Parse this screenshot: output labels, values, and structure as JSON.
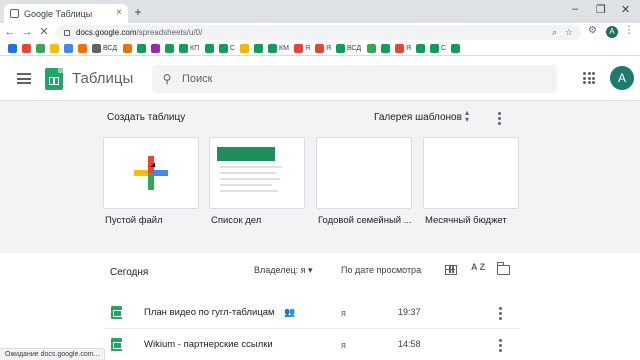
{
  "browser": {
    "tab_title": "Google Таблицы",
    "tab_close": "×",
    "new_tab": "+",
    "window_controls": [
      "–",
      "❐",
      "✕"
    ],
    "url_host": "docs.google.com",
    "url_path": "/spreadsheets/u/0/",
    "profile_initial": "A",
    "status_text": "Ожидание docs.google.com..."
  },
  "bookmarks": [
    {
      "label": "",
      "color": "#1a73e8"
    },
    {
      "label": "",
      "color": "#ea4335"
    },
    {
      "label": "",
      "color": "#34a853"
    },
    {
      "label": "",
      "color": "#fbbc04"
    },
    {
      "label": "",
      "color": "#4285f4"
    },
    {
      "label": "",
      "color": "#ff6d00"
    },
    {
      "label": "ВСД",
      "color": "#5f6368"
    },
    {
      "label": "",
      "color": "#e37400"
    },
    {
      "label": "",
      "color": "#0f9d58"
    },
    {
      "label": "",
      "color": "#9c27b0"
    },
    {
      "label": "",
      "color": "#0f9d58"
    },
    {
      "label": "КП",
      "color": "#0f9d58"
    },
    {
      "label": "",
      "color": "#0f9d58"
    },
    {
      "label": "С",
      "color": "#0f9d58"
    },
    {
      "label": "",
      "color": "#f4b400"
    },
    {
      "label": "",
      "color": "#0f9d58"
    },
    {
      "label": "КМ",
      "color": "#0f9d58"
    },
    {
      "label": "Я",
      "color": "#ea4335"
    },
    {
      "label": "Я",
      "color": "#ea4335"
    },
    {
      "label": "ВСД",
      "color": "#0f9d58"
    },
    {
      "label": "",
      "color": "#34a853"
    },
    {
      "label": "",
      "color": "#0f9d58"
    },
    {
      "label": "Я",
      "color": "#ea4335"
    },
    {
      "label": "",
      "color": "#0f9d58"
    },
    {
      "label": "С",
      "color": "#0f9d58"
    },
    {
      "label": "",
      "color": "#0f9d58"
    }
  ],
  "header": {
    "app_title": "Таблицы",
    "search_placeholder": "Поиск",
    "avatar_initial": "A"
  },
  "templates": {
    "title": "Создать таблицу",
    "gallery_link": "Галерея шаблонов",
    "cards": [
      {
        "label": "Пустой файл"
      },
      {
        "label": "Список дел"
      },
      {
        "label": "Годовой семейный ..."
      },
      {
        "label": "Месячный бюджет"
      }
    ]
  },
  "files": {
    "section_title": "Сегодня",
    "owner_filter": "Владелец: я",
    "sort_label": "По дате просмотра",
    "sort_icon_text": "A Z",
    "rows": [
      {
        "name": "План видео по гугл-таблицам",
        "owner": "я",
        "time": "19:37",
        "shared": true
      },
      {
        "name": "Wikium - партнерские ссылки",
        "owner": "я",
        "time": "14:58",
        "shared": false
      }
    ]
  }
}
